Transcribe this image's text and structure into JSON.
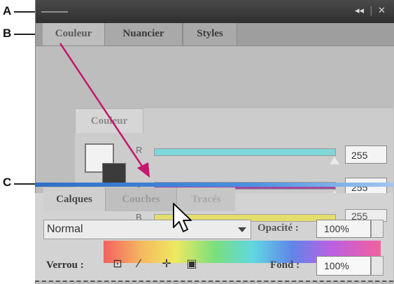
{
  "callouts": {
    "a": "A",
    "b": "B",
    "c": "C"
  },
  "window": {
    "collapse_icon": "◂◂",
    "close_icon": "✕"
  },
  "tabs": [
    "Couleur",
    "Nuancier",
    "Styles"
  ],
  "floating_panel": {
    "tab": "Couleur",
    "channels": [
      {
        "label": "R",
        "value": "255",
        "color": "#7fd8d8"
      },
      {
        "label": "V",
        "value": "255",
        "color": "#a04aa0"
      },
      {
        "label": "B",
        "value": "255",
        "color": "#e6e05a"
      }
    ]
  },
  "layers": {
    "tabs": [
      "Calques",
      "Couches",
      "Tracés"
    ],
    "blend_mode": "Normal",
    "opacity_label": "Opacité :",
    "opacity_value": "100%",
    "lock_label": "Verrou :",
    "fill_label": "Fond :",
    "fill_value": "100%"
  },
  "colors": {
    "arrow": "#c0196d",
    "drop_indicator": "#3a7fd6"
  },
  "icons": [
    "collapse-icon",
    "close-icon",
    "lock-transparent-icon",
    "lock-brush-icon",
    "lock-move-icon",
    "lock-all-icon",
    "pointer-cursor-icon"
  ]
}
